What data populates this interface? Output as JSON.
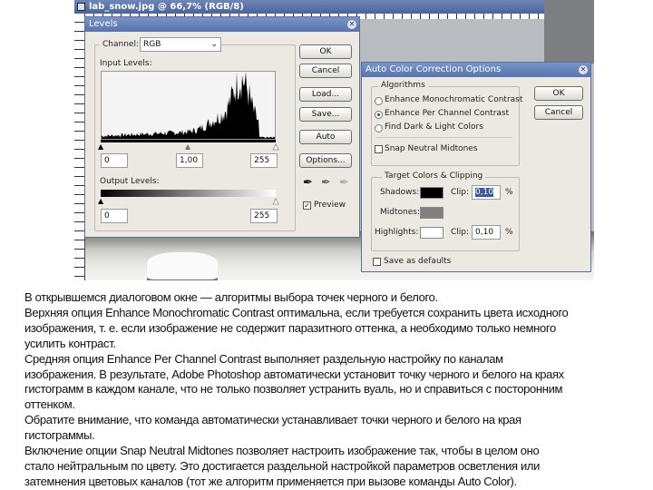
{
  "document": {
    "title": "lab_snow.jpg @ 66,7% (RGB/8)"
  },
  "levels": {
    "title": "Levels",
    "channel_label": "Channel:",
    "channel_value": "RGB",
    "input_levels_label": "Input Levels:",
    "input_black": "0",
    "input_gamma": "1,00",
    "input_white": "255",
    "output_levels_label": "Output Levels:",
    "output_black": "0",
    "output_white": "255",
    "buttons": {
      "ok": "OK",
      "cancel": "Cancel",
      "load": "Load...",
      "save": "Save...",
      "auto": "Auto",
      "options": "Options..."
    },
    "preview_label": "Preview",
    "preview_checked": true
  },
  "auto_color": {
    "title": "Auto Color Correction Options",
    "algorithms_label": "Algorithms",
    "options": [
      {
        "label": "Enhance Monochromatic Contrast",
        "selected": false
      },
      {
        "label": "Enhance Per Channel Contrast",
        "selected": true
      },
      {
        "label": "Find Dark & Light Colors",
        "selected": false
      }
    ],
    "snap_label": "Snap Neutral Midtones",
    "snap_checked": false,
    "target_label": "Target Colors & Clipping",
    "shadows_label": "Shadows:",
    "midtones_label": "Midtones:",
    "highlights_label": "Highlights:",
    "clip_label": "Clip:",
    "shadows_clip": "0,10",
    "highlights_clip": "0,10",
    "percent": "%",
    "colors": {
      "shadows": "#000000",
      "midtones": "#808080",
      "highlights": "#ffffff"
    },
    "save_defaults_label": "Save as defaults",
    "save_defaults_checked": false,
    "buttons": {
      "ok": "OK",
      "cancel": "Cancel"
    }
  },
  "text_lines": [
    "В открывшемся диалоговом окне — алгоритмы выбора точек черного и белого.",
    "Верхняя опция Enhance Monochromatic Contrast оптимальна, если требуется сохранить цвета исходного",
    "изображения, т. е. если изображение не содержит паразитного оттенка, а необходимо только немного",
    "усилить контраст.",
    "Средняя опция Enhance Per Channel Contrast выполняет раздельную настройку по каналам",
    "изображения. В результате, Adobe Photoshop автоматически установит точку черного и белого на краях",
    "гистограмм в каждом канале, что не только позволяет устранить вуаль, но и справиться с посторонним",
    "оттенком.",
    "Обратите внимание, что команда автоматически устанавливает точки черного и белого на края",
    "гистограммы.",
    "Включение опции Snap Neutral Midtones позволяет настроить изображение так, чтобы в целом оно",
    "стало нейтральным по цвету. Это достигается раздельной настройкой параметров осветления или",
    "затемнения цветовых каналов (тот же алгоритм применяется при вызове команды Auto Color)."
  ]
}
